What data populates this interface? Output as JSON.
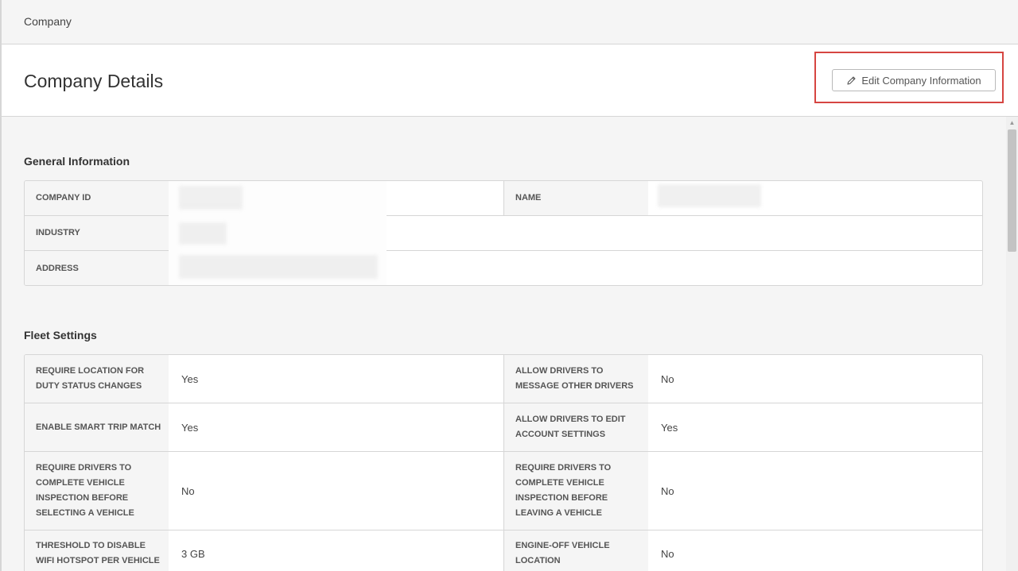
{
  "breadcrumb": "Company",
  "header": {
    "title": "Company Details",
    "edit_button_label": "Edit Company Information",
    "edit_icon": "pencil-icon"
  },
  "general_info": {
    "title": "General Information",
    "company_id_label": "COMPANY ID",
    "name_label": "NAME",
    "industry_label": "INDUSTRY",
    "address_label": "ADDRESS"
  },
  "fleet_settings": {
    "title": "Fleet Settings",
    "rows": [
      {
        "left_label": "REQUIRE LOCATION FOR DUTY STATUS CHANGES",
        "left_value": "Yes",
        "right_label": "ALLOW DRIVERS TO MESSAGE OTHER DRIVERS",
        "right_value": "No"
      },
      {
        "left_label": "ENABLE SMART TRIP MATCH",
        "left_value": "Yes",
        "right_label": "ALLOW DRIVERS TO EDIT ACCOUNT SETTINGS",
        "right_value": "Yes"
      },
      {
        "left_label": "REQUIRE DRIVERS TO COMPLETE VEHICLE INSPECTION BEFORE SELECTING A VEHICLE",
        "left_value": "No",
        "right_label": "REQUIRE DRIVERS TO COMPLETE VEHICLE INSPECTION BEFORE LEAVING A VEHICLE",
        "right_value": "No"
      },
      {
        "left_label": "THRESHOLD TO DISABLE WIFI HOTSPOT PER VEHICLE",
        "left_value": "3 GB",
        "right_label": "ENGINE-OFF VEHICLE LOCATION",
        "right_value": "No"
      }
    ]
  },
  "colors": {
    "highlight": "#d64541",
    "label_bg": "#f5f5f5",
    "border": "#d6d6d6"
  }
}
